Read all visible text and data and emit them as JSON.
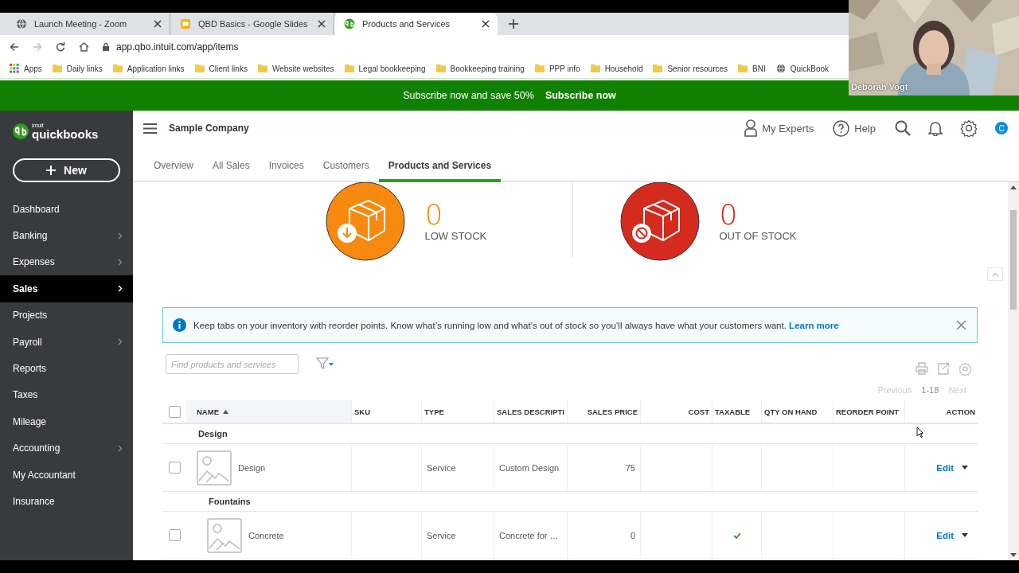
{
  "browser": {
    "tabs": [
      {
        "title": "Launch Meeting - Zoom",
        "kind": "globe",
        "selected": false
      },
      {
        "title": "QBD Basics - Google Slides",
        "kind": "slides",
        "selected": false
      },
      {
        "title": "Products and Services",
        "kind": "quickbooks",
        "selected": true
      }
    ],
    "address": "app.qbo.intuit.com/app/items",
    "bookmarks": [
      {
        "label": "Apps",
        "kind": "apps"
      },
      {
        "label": "Daily links",
        "kind": "folder"
      },
      {
        "label": "Application links",
        "kind": "folder"
      },
      {
        "label": "Client links",
        "kind": "folder"
      },
      {
        "label": "Website websites",
        "kind": "folder"
      },
      {
        "label": "Legal bookkeeping",
        "kind": "folder"
      },
      {
        "label": "Bookkeeping training",
        "kind": "folder"
      },
      {
        "label": "PPP info",
        "kind": "folder"
      },
      {
        "label": "Household",
        "kind": "folder"
      },
      {
        "label": "Senior resources",
        "kind": "folder"
      },
      {
        "label": "BNI",
        "kind": "folder"
      },
      {
        "label": "QuickBook",
        "kind": "site"
      }
    ]
  },
  "video_overlay": {
    "kind": "picture",
    "name": "Deborah Vogt"
  },
  "promo_banner": {
    "text": "Subscribe now and save 50%",
    "link": "Subscribe now"
  },
  "sidebar": {
    "logo_top": "intuit",
    "logo": "quickbooks",
    "new_button": "New",
    "items": [
      {
        "label": "Dashboard",
        "selected": false,
        "has_submenu": false
      },
      {
        "label": "Banking",
        "selected": false,
        "has_submenu": true
      },
      {
        "label": "Expenses",
        "selected": false,
        "has_submenu": true
      },
      {
        "label": "Sales",
        "selected": true,
        "has_submenu": true
      },
      {
        "label": "Projects",
        "selected": false,
        "has_submenu": false
      },
      {
        "label": "Payroll",
        "selected": false,
        "has_submenu": true
      },
      {
        "label": "Reports",
        "selected": false,
        "has_submenu": false
      },
      {
        "label": "Taxes",
        "selected": false,
        "has_submenu": false
      },
      {
        "label": "Mileage",
        "selected": false,
        "has_submenu": false
      },
      {
        "label": "Accounting",
        "selected": false,
        "has_submenu": true
      },
      {
        "label": "My Accountant",
        "selected": false,
        "has_submenu": false
      },
      {
        "label": "Insurance",
        "selected": false,
        "has_submenu": false
      }
    ]
  },
  "header": {
    "company": "Sample Company",
    "experts": "My Experts",
    "help": "Help",
    "avatar": "C"
  },
  "nav_tabs": [
    {
      "label": "Overview",
      "selected": false
    },
    {
      "label": "All Sales",
      "selected": false
    },
    {
      "label": "Invoices",
      "selected": false
    },
    {
      "label": "Customers",
      "selected": false
    },
    {
      "label": "Products and Services",
      "selected": true
    }
  ],
  "stock_cards": [
    {
      "kind": "low",
      "count": "0",
      "label": "LOW STOCK"
    },
    {
      "kind": "out",
      "count": "0",
      "label": "OUT OF STOCK"
    }
  ],
  "info_banner": {
    "text": "Keep tabs on your inventory with reorder points. Know what’s running low and what’s out of stock so you’ll always have what your customers want.",
    "link": "Learn more"
  },
  "search": {
    "placeholder": "Find products and services"
  },
  "pagination": {
    "previous": "Previous",
    "range": "1-18",
    "next": "Next",
    "previous_disabled": true,
    "next_disabled": true
  },
  "table": {
    "select_all_checked": false,
    "columns": [
      {
        "label": "NAME",
        "sorted": true
      },
      {
        "label": "SKU",
        "sorted": false
      },
      {
        "label": "TYPE",
        "sorted": false
      },
      {
        "label": "SALES DESCRIPTI",
        "sorted": false
      },
      {
        "label": "SALES PRICE",
        "sorted": false
      },
      {
        "label": "COST",
        "sorted": false
      },
      {
        "label": "TAXABLE",
        "sorted": false
      },
      {
        "label": "QTY ON HAND",
        "sorted": false
      },
      {
        "label": "REORDER POINT",
        "sorted": false
      },
      {
        "label": "ACTION",
        "sorted": false
      }
    ],
    "rows": [
      {
        "kind": "category",
        "name": "Design",
        "children": [
          {
            "kind": "item",
            "checked": false,
            "name": "Design",
            "type": "Service",
            "sales_description": "Custom Design",
            "sales_price": "75",
            "taxable": false,
            "action": "Edit"
          },
          {
            "kind": "category",
            "name": "Fountains",
            "children": [
              {
                "kind": "item",
                "checked": false,
                "name": "Concrete",
                "type": "Service",
                "sales_description": "Concrete for …",
                "sales_price": "0",
                "taxable": true,
                "action": "Edit"
              }
            ]
          }
        ]
      }
    ]
  }
}
